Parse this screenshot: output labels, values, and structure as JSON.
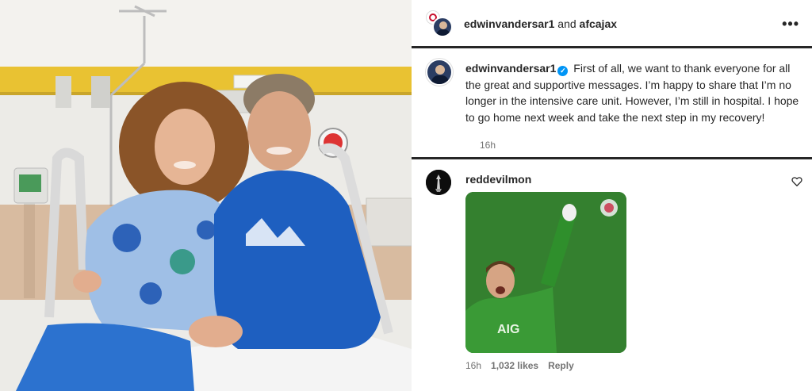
{
  "header": {
    "account": "edwinvandersar1",
    "conjunction": "and",
    "collaborator": "afcajax",
    "more_icon": "more-horizontal-icon"
  },
  "post": {
    "username": "edwinvandersar1",
    "verified": true,
    "caption": "First of all, we want to thank everyone for all the great and supportive messages. I’m happy to share that I’m no longer in the intensive care unit. However, I’m still in hospital. I hope to go home next week and take the next step in my recovery!",
    "time": "16h"
  },
  "comment": {
    "username": "reddevilmon",
    "time": "16h",
    "likes": "1,032 likes",
    "reply_label": "Reply",
    "gif_text": "AIG"
  },
  "colors": {
    "verified_blue": "#0095f6",
    "muted_text": "#737373",
    "hoodie_blue": "#1e5fc0",
    "pitch_green": "#2f7a2b"
  }
}
